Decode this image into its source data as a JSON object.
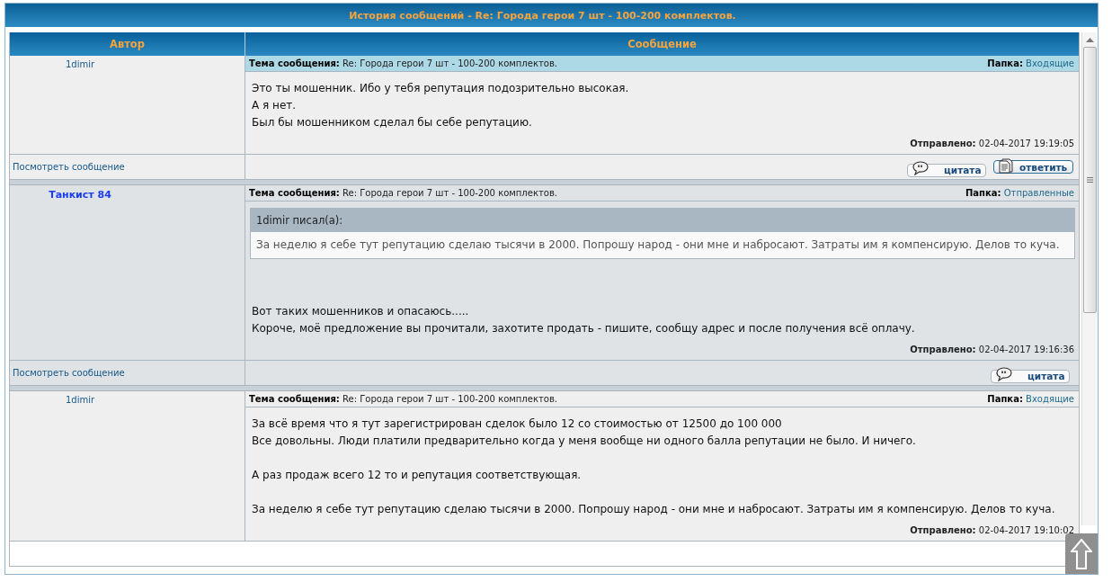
{
  "window": {
    "title": "История сообщений - Re: Города герои 7 шт - 100-200 комплектов."
  },
  "table": {
    "columns": [
      "Автор",
      "Сообщение"
    ]
  },
  "messages": [
    {
      "author": "1dimir",
      "own": false,
      "highlighted": true,
      "subject_label": "Тема сообщения:",
      "subject": "Re: Города герои 7 шт - 100-200 комплектов.",
      "folder_label": "Папка:",
      "folder": "Входящие",
      "paragraphs": [
        [
          "Это ты мошенник. Ибо у тебя репутация подозрительно высокая.",
          "А я нет.",
          "Был бы мошенником сделал бы себе репутацию."
        ]
      ],
      "sent_label": "Отправлено:",
      "sent": "02-04-2017 19:19:05",
      "view_link": "Посмотреть сообщение",
      "buttons": [
        {
          "kind": "quote",
          "label": "цитата"
        },
        {
          "kind": "reply",
          "label": "ответить"
        }
      ]
    },
    {
      "author": "Танкист 84",
      "own": true,
      "highlighted": false,
      "subject_label": "Тема сообщения:",
      "subject": "Re: Города герои 7 шт - 100-200 комплектов.",
      "folder_label": "Папка:",
      "folder": "Отправленные",
      "quote": {
        "header": "1dimir писал(а):",
        "text": "За неделю я себе тут репутацию сделаю тысячи в 2000. Попрошу народ - они мне и набросают. Затраты им я компенсирую. Делов то куча."
      },
      "paragraphs": [
        [
          "Вот таких мошенников и опасаюсь.....",
          "Короче, моё предложение вы прочитали, захотите продать - пишите, сообщу адрес и после получения всё оплачу."
        ]
      ],
      "sent_label": "Отправлено:",
      "sent": "02-04-2017 19:16:36",
      "view_link": "Посмотреть сообщение",
      "buttons": [
        {
          "kind": "quote",
          "label": "цитата"
        }
      ]
    },
    {
      "author": "1dimir",
      "own": false,
      "highlighted": false,
      "subject_label": "Тема сообщения:",
      "subject": "Re: Города герои 7 шт - 100-200 комплектов.",
      "folder_label": "Папка:",
      "folder": "Входящие",
      "paragraphs": [
        [
          "За всё время что я тут зарегистрирован сделок было 12 со стоимостью от 12500 до 100 000",
          "Все довольны. Люди платили предварительно когда у меня вообще ни одного балла репутации не было. И ничего."
        ],
        [
          "А раз продаж всего 12 то и репутация соответствующая."
        ],
        [
          "За неделю я себе тут репутацию сделаю тысячи в 2000. Попрошу народ - они мне и набросают. Затраты им я компенсирую. Делов то куча."
        ]
      ],
      "sent_label": "Отправлено:",
      "sent": "02-04-2017 19:10:02"
    }
  ]
}
